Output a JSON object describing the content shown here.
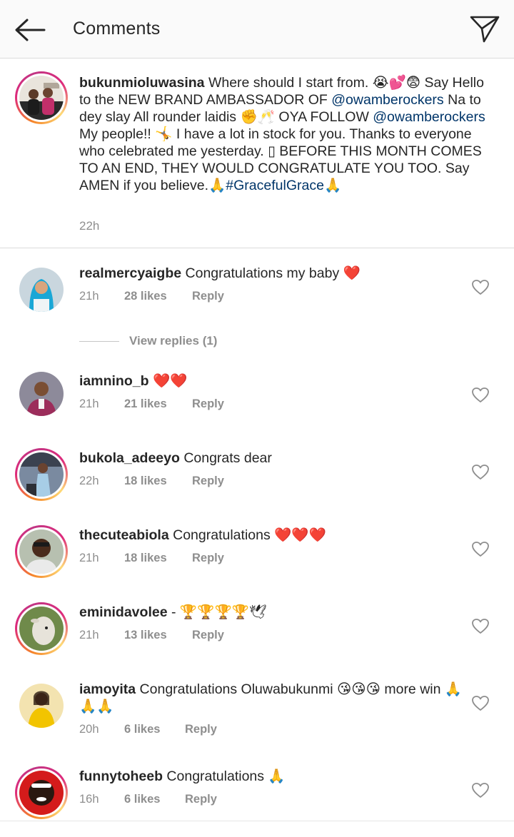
{
  "header": {
    "title": "Comments"
  },
  "caption": {
    "username": "bukunmioluwasina",
    "segments": [
      {
        "t": " Where should I start from. 😭💕😨 Say Hello to the NEW BRAND AMBASSADOR OF ",
        "m": false
      },
      {
        "t": "@owamberockers",
        "m": true
      },
      {
        "t": " Na to dey slay All rounder laidis ✊🥂 OYA FOLLOW ",
        "m": false
      },
      {
        "t": "@owamberockers",
        "m": true
      },
      {
        "t": " My people!! 🤸 I have a lot in stock for you. Thanks to everyone who celebrated me yesterday. ▯ BEFORE THIS MONTH COMES TO AN END, THEY WOULD CONGRATULATE YOU TOO. Say AMEN if you believe.🙏",
        "m": false
      },
      {
        "t": "#GracefulGrace",
        "m": true
      },
      {
        "t": "🙏",
        "m": false
      }
    ],
    "time": "22h"
  },
  "comments": [
    {
      "username": "realmercyaigbe",
      "text": "Congratulations my baby ❤️",
      "time": "21h",
      "likes": "28 likes",
      "reply": "Reply"
    },
    {
      "username": "iamnino_b",
      "text": "❤️❤️",
      "time": "21h",
      "likes": "21 likes",
      "reply": "Reply"
    },
    {
      "username": "bukola_adeeyo",
      "text": "Congrats dear",
      "time": "22h",
      "likes": "18 likes",
      "reply": "Reply"
    },
    {
      "username": "thecuteabiola",
      "text": "Congratulations ❤️❤️❤️",
      "time": "21h",
      "likes": "18 likes",
      "reply": "Reply"
    },
    {
      "username": "eminidavolee",
      "text": "- 🏆🏆🏆🏆🕊",
      "time": "21h",
      "likes": "13 likes",
      "reply": "Reply"
    },
    {
      "username": "iamoyita",
      "text": "Congratulations Oluwabukunmi 😘😘😘 more win 🙏🙏🙏",
      "time": "20h",
      "likes": "6 likes",
      "reply": "Reply"
    },
    {
      "username": "funnytoheeb",
      "text": "Congratulations 🙏",
      "time": "16h",
      "likes": "6 likes",
      "reply": "Reply"
    }
  ],
  "view_replies": "View replies (1)",
  "icons": {
    "back": "back-arrow-icon",
    "send": "direct-send-icon",
    "heart": "heart-outline-icon"
  },
  "colors": {
    "text": "#262626",
    "muted": "#8e8e8e",
    "mention": "#003569",
    "divider": "#dbdbdb"
  }
}
